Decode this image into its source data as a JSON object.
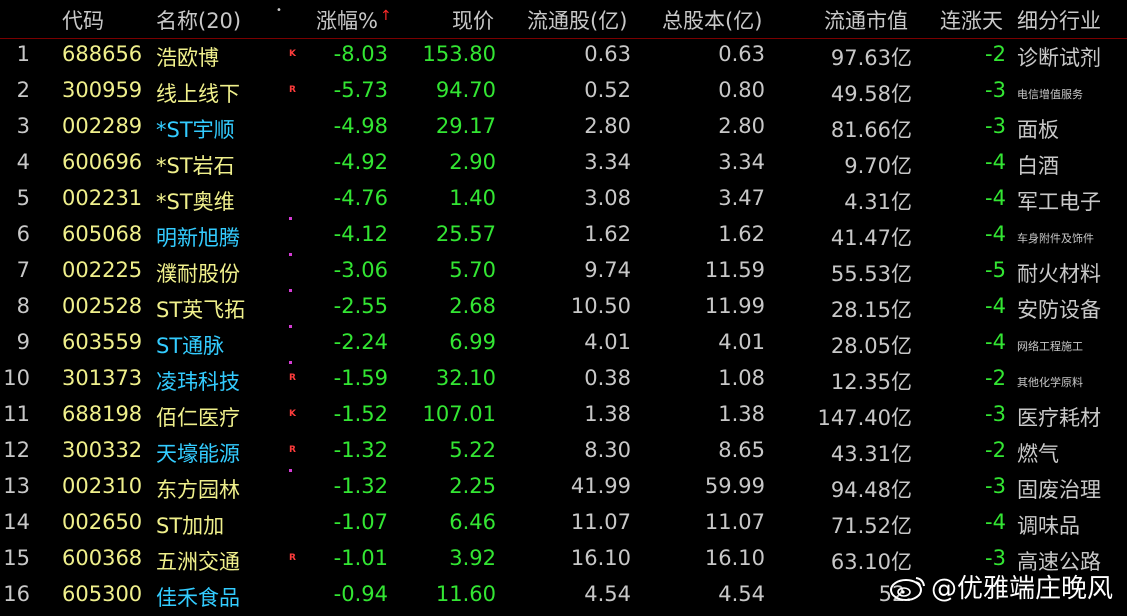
{
  "header": {
    "code": "代码",
    "name": "名称(20)",
    "dot": "•",
    "pct": "涨幅%",
    "sort_arrow": "↑",
    "price": "现价",
    "float_shares": "流通股(亿)",
    "total_shares": "总股本(亿)",
    "float_mcap": "流通市值",
    "streak": "连涨天",
    "industry": "细分行业"
  },
  "rows": [
    {
      "idx": "1",
      "code": "688656",
      "name": "浩欧博",
      "name_color": "yellow",
      "tag": "K",
      "mark": false,
      "pct": "-8.03",
      "price": "153.80",
      "float": "0.63",
      "total": "0.63",
      "mcap": "97.63亿",
      "streak": "-2",
      "industry": "诊断试剂",
      "ind_small": false
    },
    {
      "idx": "2",
      "code": "300959",
      "name": "线上线下",
      "name_color": "yellow",
      "tag": "R",
      "mark": false,
      "pct": "-5.73",
      "price": "94.70",
      "float": "0.52",
      "total": "0.80",
      "mcap": "49.58亿",
      "streak": "-3",
      "industry": "电信增值服务",
      "ind_small": true
    },
    {
      "idx": "3",
      "code": "002289",
      "name": "*ST宇顺",
      "name_color": "cyan",
      "tag": "",
      "mark": false,
      "pct": "-4.98",
      "price": "29.17",
      "float": "2.80",
      "total": "2.80",
      "mcap": "81.66亿",
      "streak": "-3",
      "industry": "面板",
      "ind_small": false
    },
    {
      "idx": "4",
      "code": "600696",
      "name": "*ST岩石",
      "name_color": "yellow",
      "tag": "",
      "mark": false,
      "pct": "-4.92",
      "price": "2.90",
      "float": "3.34",
      "total": "3.34",
      "mcap": "9.70亿",
      "streak": "-4",
      "industry": "白酒",
      "ind_small": false
    },
    {
      "idx": "5",
      "code": "002231",
      "name": "*ST奥维",
      "name_color": "yellow",
      "tag": "",
      "mark": false,
      "pct": "-4.76",
      "price": "1.40",
      "float": "3.08",
      "total": "3.47",
      "mcap": "4.31亿",
      "streak": "-4",
      "industry": "军工电子",
      "ind_small": false
    },
    {
      "idx": "6",
      "code": "605068",
      "name": "明新旭腾",
      "name_color": "cyan",
      "tag": "",
      "mark": true,
      "pct": "-4.12",
      "price": "25.57",
      "float": "1.62",
      "total": "1.62",
      "mcap": "41.47亿",
      "streak": "-4",
      "industry": "车身附件及饰件",
      "ind_small": true
    },
    {
      "idx": "7",
      "code": "002225",
      "name": "濮耐股份",
      "name_color": "yellow",
      "tag": "",
      "mark": true,
      "pct": "-3.06",
      "price": "5.70",
      "float": "9.74",
      "total": "11.59",
      "mcap": "55.53亿",
      "streak": "-5",
      "industry": "耐火材料",
      "ind_small": false
    },
    {
      "idx": "8",
      "code": "002528",
      "name": "ST英飞拓",
      "name_color": "yellow",
      "tag": "",
      "mark": true,
      "pct": "-2.55",
      "price": "2.68",
      "float": "10.50",
      "total": "11.99",
      "mcap": "28.15亿",
      "streak": "-4",
      "industry": "安防设备",
      "ind_small": false
    },
    {
      "idx": "9",
      "code": "603559",
      "name": "ST通脉",
      "name_color": "cyan",
      "tag": "",
      "mark": true,
      "pct": "-2.24",
      "price": "6.99",
      "float": "4.01",
      "total": "4.01",
      "mcap": "28.05亿",
      "streak": "-4",
      "industry": "网络工程施工",
      "ind_small": true
    },
    {
      "idx": "10",
      "code": "301373",
      "name": "凌玮科技",
      "name_color": "cyan",
      "tag": "R",
      "mark": true,
      "pct": "-1.59",
      "price": "32.10",
      "float": "0.38",
      "total": "1.08",
      "mcap": "12.35亿",
      "streak": "-2",
      "industry": "其他化学原料",
      "ind_small": true
    },
    {
      "idx": "11",
      "code": "688198",
      "name": "佰仁医疗",
      "name_color": "yellow",
      "tag": "K",
      "mark": false,
      "pct": "-1.52",
      "price": "107.01",
      "float": "1.38",
      "total": "1.38",
      "mcap": "147.40亿",
      "streak": "-3",
      "industry": "医疗耗材",
      "ind_small": false
    },
    {
      "idx": "12",
      "code": "300332",
      "name": "天壕能源",
      "name_color": "cyan",
      "tag": "R",
      "mark": false,
      "pct": "-1.32",
      "price": "5.22",
      "float": "8.30",
      "total": "8.65",
      "mcap": "43.31亿",
      "streak": "-2",
      "industry": "燃气",
      "ind_small": false
    },
    {
      "idx": "13",
      "code": "002310",
      "name": "东方园林",
      "name_color": "yellow",
      "tag": "",
      "mark": true,
      "pct": "-1.32",
      "price": "2.25",
      "float": "41.99",
      "total": "59.99",
      "mcap": "94.48亿",
      "streak": "-3",
      "industry": "固废治理",
      "ind_small": false
    },
    {
      "idx": "14",
      "code": "002650",
      "name": "ST加加",
      "name_color": "yellow",
      "tag": "",
      "mark": false,
      "pct": "-1.07",
      "price": "6.46",
      "float": "11.07",
      "total": "11.07",
      "mcap": "71.52亿",
      "streak": "-4",
      "industry": "调味品",
      "ind_small": false
    },
    {
      "idx": "15",
      "code": "600368",
      "name": "五洲交通",
      "name_color": "yellow",
      "tag": "R",
      "mark": false,
      "pct": "-1.01",
      "price": "3.92",
      "float": "16.10",
      "total": "16.10",
      "mcap": "63.10亿",
      "streak": "-3",
      "industry": "高速公路",
      "ind_small": false
    },
    {
      "idx": "16",
      "code": "605300",
      "name": "佳禾食品",
      "name_color": "cyan",
      "tag": "",
      "mark": false,
      "pct": "-0.94",
      "price": "11.60",
      "float": "4.54",
      "total": "4.54",
      "mcap": "52.",
      "streak": "",
      "industry": "",
      "ind_small": false
    }
  ],
  "watermark": {
    "text": "@优雅端庄晚风",
    "icon": "weibo-icon"
  },
  "colors": {
    "background": "#000000",
    "code": "#f0f08c",
    "name_cyan": "#33ccff",
    "negative": "#33e633",
    "tag": "#ff3c3c",
    "header_rule": "#7a0000"
  }
}
